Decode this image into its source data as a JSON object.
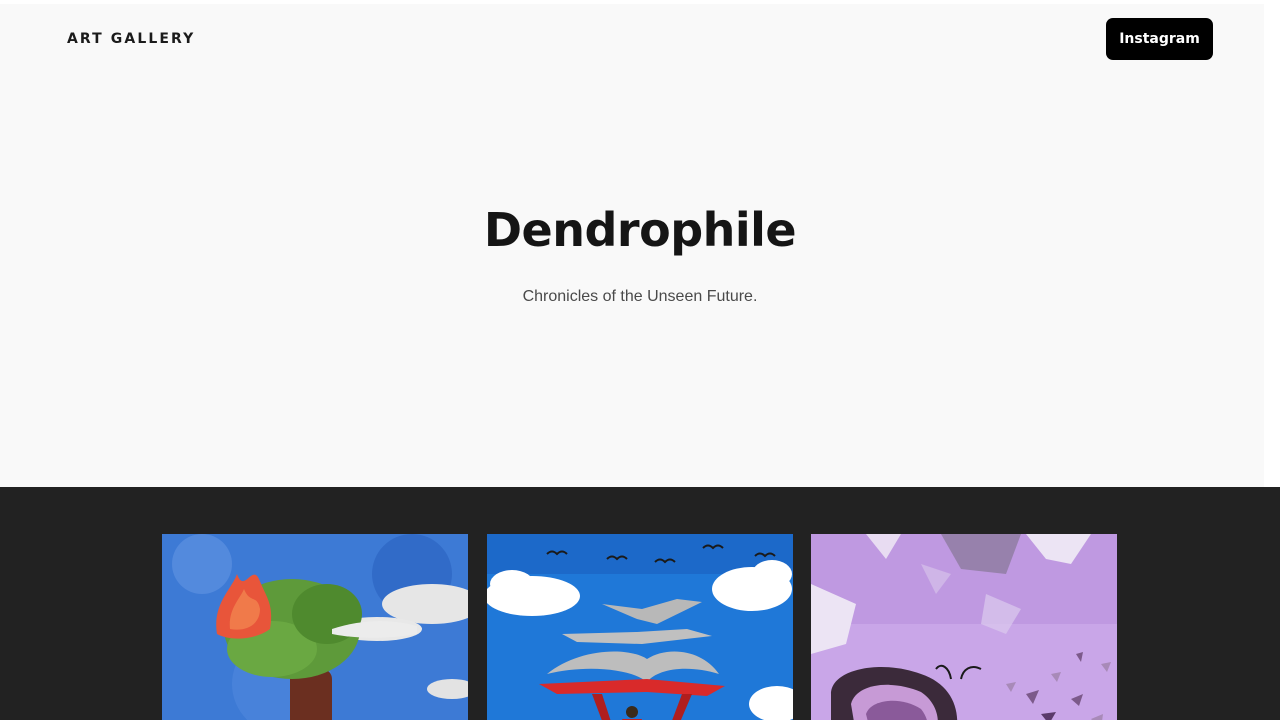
{
  "header": {
    "brand": "ART GALLERY",
    "instagram_label": "Instagram"
  },
  "hero": {
    "title": "Dendrophile",
    "subtitle": "Chronicles of the Unseen Future."
  },
  "gallery": {
    "artworks": [
      {
        "subject": "tree with burning crown and clouds",
        "colors": [
          "#2f6fd0",
          "#5e9a3a",
          "#e8553a",
          "#e8e8e8"
        ]
      },
      {
        "subject": "red hang glider under flying book birds",
        "colors": [
          "#1f78d8",
          "#d92a2a",
          "#b8b8b8",
          "#ffffff"
        ]
      },
      {
        "subject": "purple butterfly with geometric shards",
        "colors": [
          "#c9a6e8",
          "#3b2a3a",
          "#e8dcf2",
          "#8a6a9a"
        ]
      }
    ]
  },
  "colors": {
    "hero_bg": "#f9f9f9",
    "gallery_bg": "#222222",
    "button_bg": "#000000",
    "title": "#151515"
  }
}
